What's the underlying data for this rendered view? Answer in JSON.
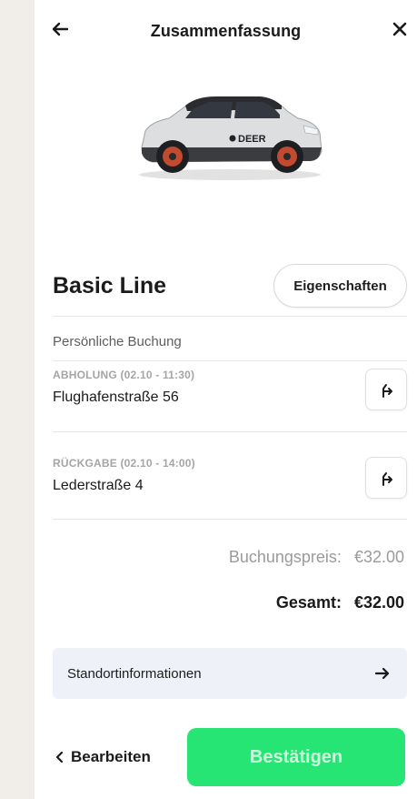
{
  "header": {
    "title": "Zusammenfassung",
    "back_icon": "arrow-left-icon",
    "close_icon": "close-icon"
  },
  "car": {
    "image": "car-image",
    "brand_text": "DEER"
  },
  "product": {
    "name": "Basic Line",
    "properties_label": "Eigenschaften"
  },
  "booking": {
    "type_label": "Persönliche Buchung",
    "pickup": {
      "label": "ABHOLUNG (02.10 - 11:30)",
      "address": "Flughafenstraße 56",
      "route_icon": "directions-icon"
    },
    "return": {
      "label": "RÜCKGABE (02.10 - 14:00)",
      "address": "Lederstraße 4",
      "route_icon": "directions-icon"
    }
  },
  "pricing": {
    "booking_price_label": "Buchungspreis:",
    "booking_price_value": "€32.00",
    "total_label": "Gesamt:",
    "total_value": "€32.00"
  },
  "location_info": {
    "label": "Standortinformationen",
    "arrow_icon": "arrow-right-icon"
  },
  "footer": {
    "edit_icon": "chevron-left-icon",
    "edit_label": "Bearbeiten",
    "confirm_label": "Bestätigen"
  },
  "colors": {
    "accent_green": "#27e574",
    "background": "#f1ede8",
    "info_bar": "#eef1f7"
  }
}
